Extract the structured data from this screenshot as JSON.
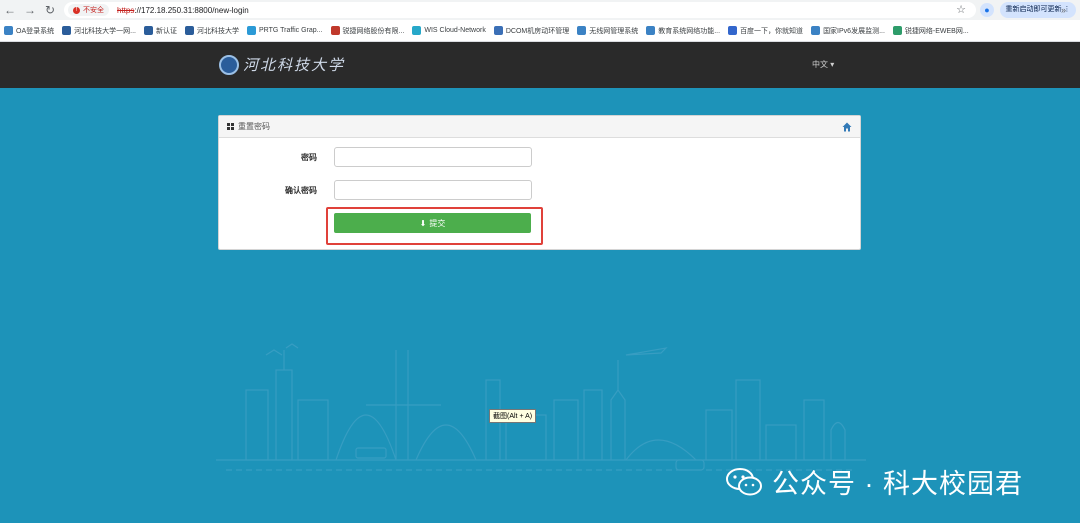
{
  "browser": {
    "security_label": "不安全",
    "url_scheme": "https",
    "url_rest": "://172.18.250.31:8800/new-login",
    "update_button": "重新启动即可更新",
    "bookmarks": [
      {
        "label": "OA登录系统",
        "color": "#3b82c4"
      },
      {
        "label": "河北科技大学一网...",
        "color": "#2b5d9a"
      },
      {
        "label": "新认证",
        "color": "#2b5d9a"
      },
      {
        "label": "河北科技大学",
        "color": "#2b5d9a"
      },
      {
        "label": "PRTG Traffic Grap...",
        "color": "#2b9ad6"
      },
      {
        "label": "锐捷网络股份有限...",
        "color": "#c0392b"
      },
      {
        "label": "WIS Cloud-Network",
        "color": "#27a8c9"
      },
      {
        "label": "DCOM机房动环管理",
        "color": "#3b6fb6"
      },
      {
        "label": "无线网管理系统",
        "color": "#3b82c4"
      },
      {
        "label": "教育系统网络功能...",
        "color": "#3b82c4"
      },
      {
        "label": "百度一下，你就知道",
        "color": "#3366cc"
      },
      {
        "label": "国家IPv6发展监测...",
        "color": "#3b82c4"
      },
      {
        "label": "锐捷网络-EWEB网...",
        "color": "#2e9c6a"
      }
    ]
  },
  "header": {
    "logo_text": "河北科技大学",
    "language": "中文 ▾"
  },
  "panel": {
    "title": "重置密码",
    "password_label": "密码",
    "confirm_label": "确认密码",
    "password_value": "",
    "confirm_value": "",
    "submit_label": "提交"
  },
  "tooltip": "截图(Alt + A)",
  "watermark": "公众号 · 科大校园君",
  "colors": {
    "background": "#1d93b9",
    "header": "#2a2a2a",
    "submit": "#4cae4c",
    "highlight": "#e0413a"
  }
}
